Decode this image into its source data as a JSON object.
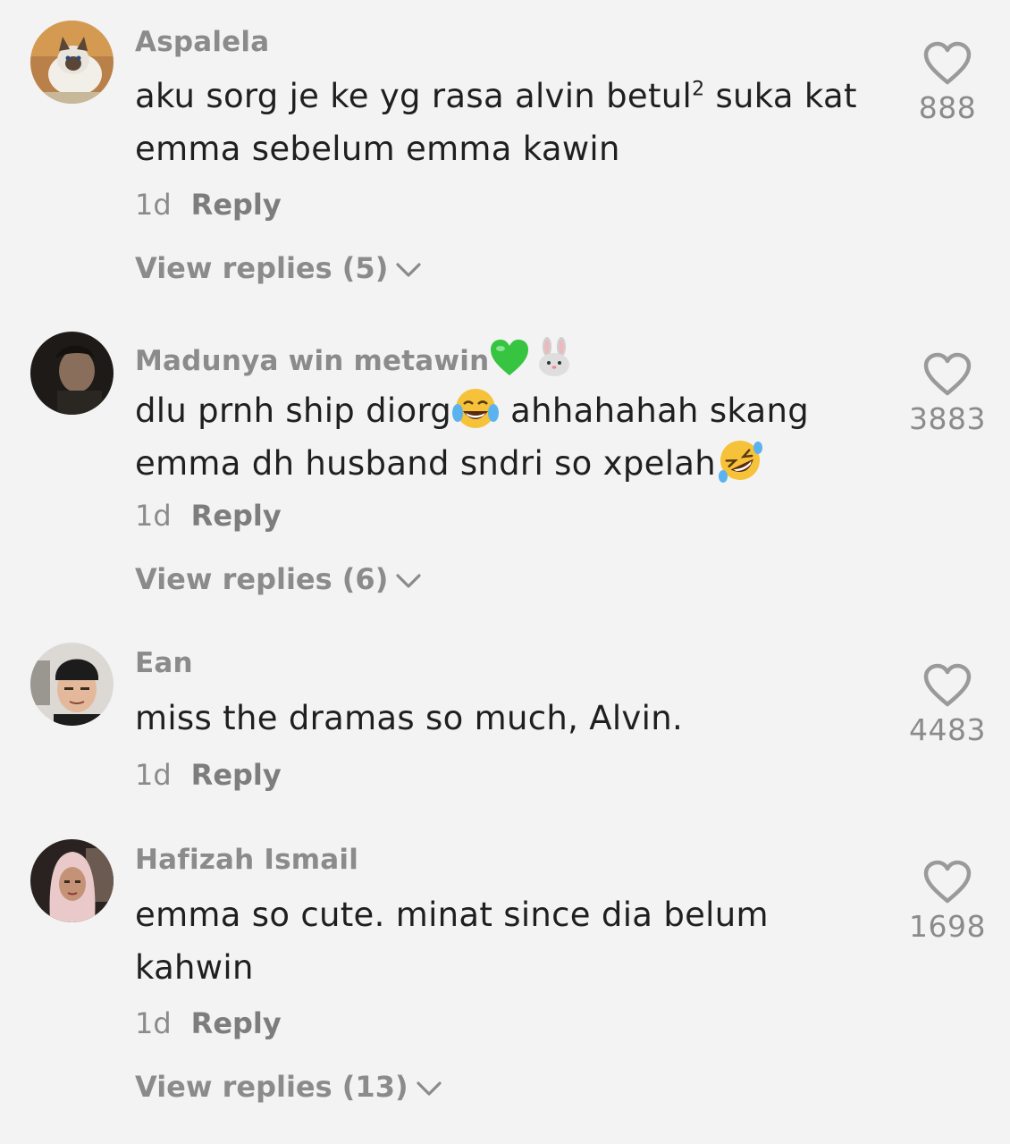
{
  "comments": [
    {
      "username": "Aspalela",
      "text_line1_pre": "aku sorg je ke yg rasa alvin betul",
      "text_sup": "2",
      "text_line1_post": " suka kat",
      "text_line2": "emma sebelum emma kawin",
      "time": "1d",
      "reply_label": "Reply",
      "view_replies": "View replies (5)",
      "likes": "888",
      "avatar": "cat-avatar"
    },
    {
      "username": "Madunya win metawin",
      "username_emojis": [
        "green-heart-emoji",
        "rabbit-emoji"
      ],
      "text_line1_pre": "dlu prnh ship diorg",
      "text_line1_post": " ahhahahah skang",
      "text_line2": "emma dh husband sndri so xpelah",
      "inline_emojis": [
        "tears-of-joy-emoji",
        "rolling-laughing-emoji"
      ],
      "time": "1d",
      "reply_label": "Reply",
      "view_replies": "View replies (6)",
      "likes": "3883",
      "avatar": "dark-portrait-avatar"
    },
    {
      "username": "Ean",
      "text_line1": "miss the dramas so much, Alvin.",
      "time": "1d",
      "reply_label": "Reply",
      "likes": "4483",
      "avatar": "man-beanie-avatar"
    },
    {
      "username": "Hafizah Ismail",
      "text_line1": "emma so cute. minat since dia belum",
      "text_line2": "kahwin",
      "time": "1d",
      "reply_label": "Reply",
      "view_replies": "View replies (13)",
      "likes": "1698",
      "avatar": "hijab-woman-avatar"
    }
  ],
  "colors": {
    "background": "#f3f3f3",
    "username": "#8b8b8b",
    "body_text": "#1f1f1f",
    "meta": "#8b8b8b"
  }
}
